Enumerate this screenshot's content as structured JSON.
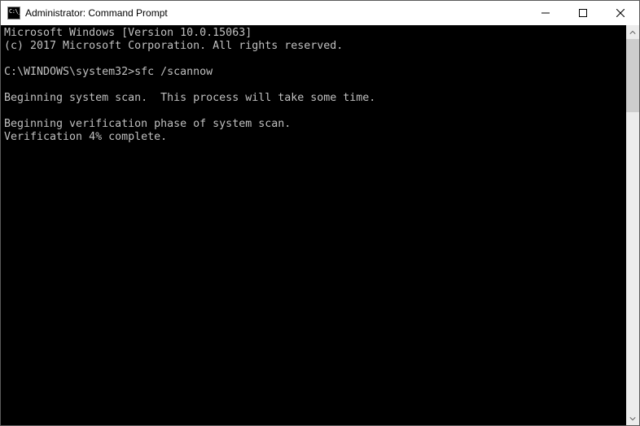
{
  "window": {
    "title": "Administrator: Command Prompt"
  },
  "terminal": {
    "lines": [
      "Microsoft Windows [Version 10.0.15063]",
      "(c) 2017 Microsoft Corporation. All rights reserved.",
      "",
      "C:\\WINDOWS\\system32>sfc /scannow",
      "",
      "Beginning system scan.  This process will take some time.",
      "",
      "Beginning verification phase of system scan.",
      "Verification 4% complete."
    ]
  }
}
